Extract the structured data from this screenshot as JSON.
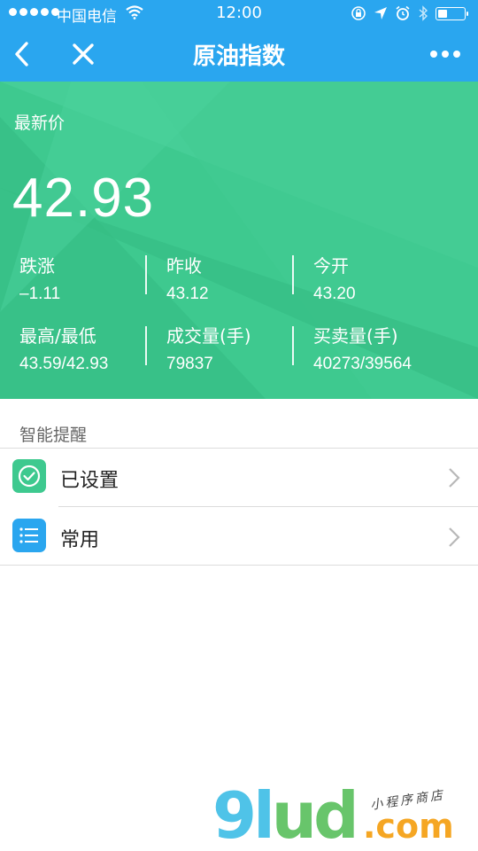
{
  "status_bar": {
    "carrier": "中国电信",
    "time": "12:00",
    "battery_level": 0.35
  },
  "nav": {
    "title": "原油指数",
    "back_icon": "chevron-left-icon",
    "close_icon": "close-icon",
    "more_icon": "more-dots-icon"
  },
  "quote": {
    "price_label": "最新价",
    "price": "42.93",
    "stats": [
      {
        "label": "跌涨",
        "value": "–1.11"
      },
      {
        "label": "昨收",
        "value": "43.12"
      },
      {
        "label": "今开",
        "value": "43.20"
      },
      {
        "label": "最高/最低",
        "value": "43.59/42.93"
      },
      {
        "label": "成交量(手)",
        "value": "79837"
      },
      {
        "label": "买卖量(手)",
        "value": "40273/39564"
      }
    ]
  },
  "reminders": {
    "title": "智能提醒",
    "items": [
      {
        "label": "已设置",
        "icon": "check-circle-icon"
      },
      {
        "label": "常用",
        "icon": "list-icon"
      }
    ]
  },
  "watermark": {
    "logo": "9lud",
    "domain": ".com",
    "tagline": "小程序商店"
  },
  "colors": {
    "nav_blue": "#2aa6ef",
    "quote_green": "#3ec98f",
    "check_green": "#3ec98f",
    "list_blue": "#2aa6ef"
  }
}
